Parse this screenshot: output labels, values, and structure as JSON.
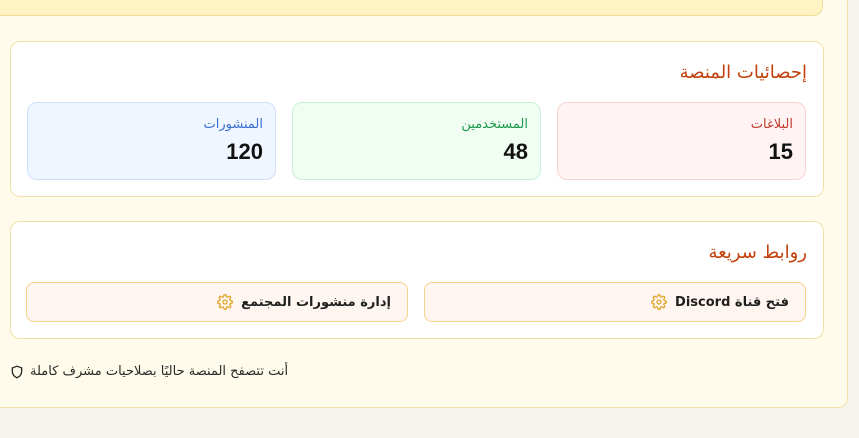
{
  "stats_section": {
    "title": "إحصائيات المنصة",
    "items": [
      {
        "label": "المنشورات",
        "value": "120"
      },
      {
        "label": "المستخدمين",
        "value": "48"
      },
      {
        "label": "البلاغات",
        "value": "15"
      }
    ]
  },
  "links_section": {
    "title": "روابط سريعة",
    "buttons": [
      {
        "label": "إدارة منشورات المجتمع",
        "icon": "gear-icon"
      },
      {
        "label": "فتح قناة Discord",
        "icon": "gear-icon"
      }
    ]
  },
  "footer": {
    "note": "أنت تتصفح المنصة حاليًا بصلاحيات مشرف كاملة",
    "icon": "shield-icon"
  },
  "colors": {
    "accent": "#c2410c",
    "posts": "#3b6fd4",
    "users": "#1f9a4b",
    "reports": "#c0392b",
    "icon": "#e0a82e"
  }
}
